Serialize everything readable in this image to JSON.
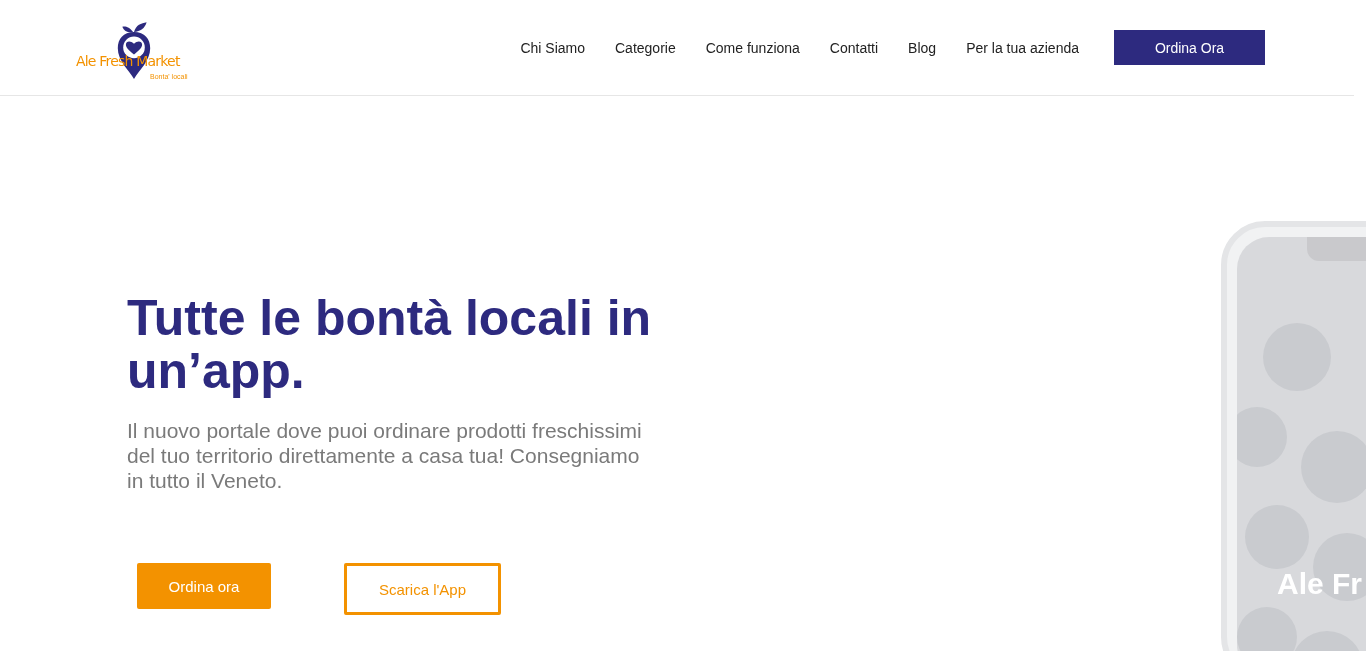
{
  "header": {
    "logo": {
      "name": "Ale Fresh Market",
      "tagline": "Bonta' locali"
    },
    "nav": [
      {
        "label": "Chi Siamo",
        "kind": "link"
      },
      {
        "label": "Categorie",
        "kind": "link"
      },
      {
        "label": "Come funziona",
        "kind": "link"
      },
      {
        "label": "Contatti",
        "kind": "link"
      },
      {
        "label": "Blog",
        "kind": "link"
      },
      {
        "label": "Per la tua azienda",
        "kind": "link"
      },
      {
        "label": "Ordina Ora",
        "kind": "button"
      }
    ]
  },
  "hero": {
    "title": "Tutte le bontà locali in un’app.",
    "subtitle": "Il nuovo portale dove puoi ordinare prodotti freschissimi del tuo territorio direttamente a casa tua! Consegniamo in tutto il Veneto.",
    "buttons": [
      {
        "label": "Ordina ora",
        "kind": "filled"
      },
      {
        "label": "Scarica l'App",
        "kind": "outline"
      }
    ],
    "phone": {
      "screen_text": "Ale Fr"
    }
  }
}
